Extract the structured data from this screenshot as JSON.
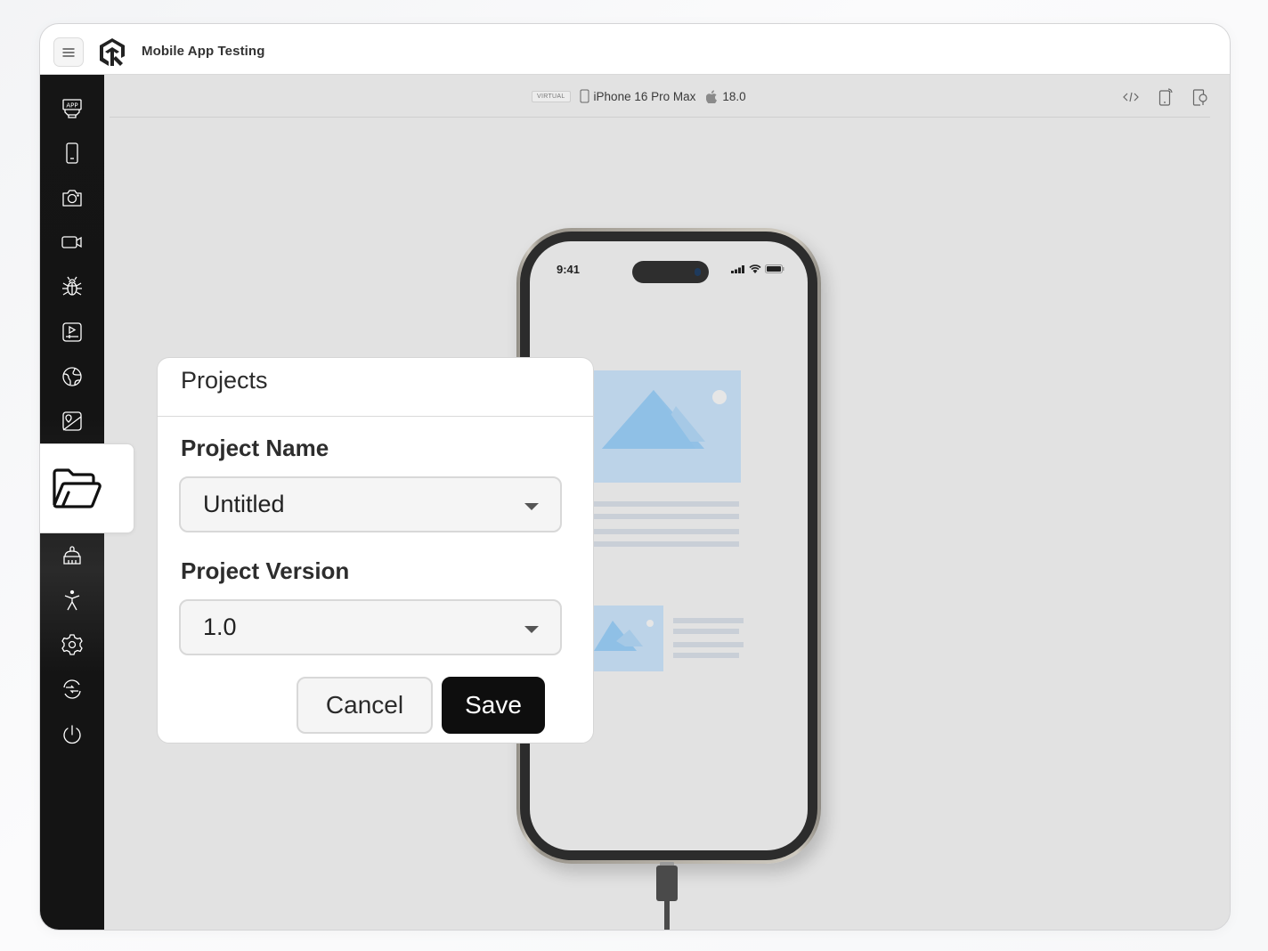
{
  "app": {
    "title": "Mobile App Testing",
    "menu_icon": "hamburger-icon",
    "logo": "app-logo"
  },
  "sidebar": {
    "items": [
      {
        "name": "app-icon",
        "label": "App"
      },
      {
        "name": "device-icon",
        "label": "Device"
      },
      {
        "name": "camera-icon",
        "label": "Screenshot"
      },
      {
        "name": "video-icon",
        "label": "Record"
      },
      {
        "name": "bug-icon",
        "label": "Bug"
      },
      {
        "name": "play-media-icon",
        "label": "Media"
      },
      {
        "name": "globe-icon",
        "label": "Location"
      },
      {
        "name": "image-location-icon",
        "label": "Image"
      },
      {
        "name": "folder-open-icon",
        "label": "Projects",
        "active": true
      },
      {
        "name": "brush-icon",
        "label": "Clean"
      },
      {
        "name": "accessibility-icon",
        "label": "Accessibility"
      },
      {
        "name": "settings-icon",
        "label": "Settings"
      },
      {
        "name": "switch-icon",
        "label": "Switch"
      },
      {
        "name": "power-icon",
        "label": "Power"
      }
    ]
  },
  "device_bar": {
    "badge": "VIRTUAL",
    "device_name": "iPhone 16 Pro Max",
    "os_version": "18.0",
    "tools": [
      "code-icon",
      "device-cast-icon",
      "device-inspect-icon"
    ]
  },
  "phone": {
    "time": "9:41"
  },
  "dialog": {
    "title": "Projects",
    "project_name_label": "Project Name",
    "project_name_value": "Untitled",
    "project_version_label": "Project Version",
    "project_version_value": "1.0",
    "cancel_label": "Cancel",
    "save_label": "Save"
  },
  "colors": {
    "sidebar_bg": "#141414",
    "primary_button": "#0e0e0e",
    "content_bg": "#e2e2e2",
    "placeholder_image": "#bcd3e8"
  }
}
